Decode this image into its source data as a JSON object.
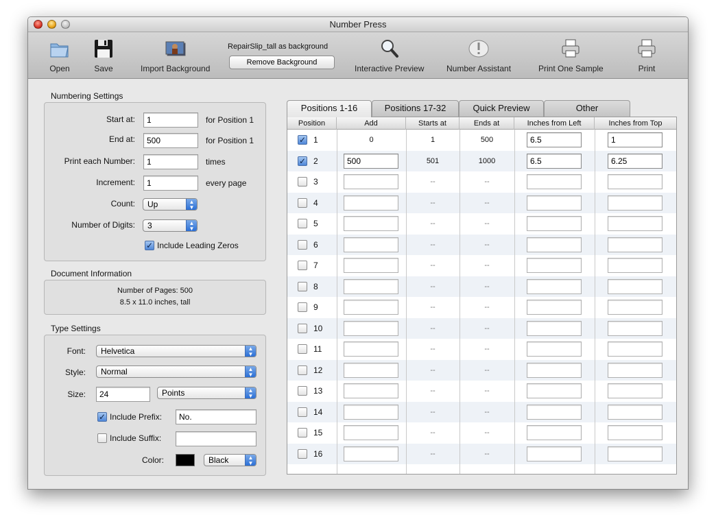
{
  "window": {
    "title": "Number Press"
  },
  "toolbar": {
    "open": "Open",
    "save": "Save",
    "import_background": "Import Background",
    "background_caption": "RepairSlip_tall as background",
    "remove_background": "Remove Background",
    "interactive_preview": "Interactive Preview",
    "number_assistant": "Number Assistant",
    "print_one_sample": "Print One Sample",
    "print": "Print"
  },
  "numbering": {
    "title": "Numbering Settings",
    "start_label": "Start at:",
    "start_value": "1",
    "start_suffix": "for Position 1",
    "end_label": "End at:",
    "end_value": "500",
    "end_suffix": "for Position 1",
    "each_label": "Print each Number:",
    "each_value": "1",
    "each_suffix": "times",
    "increment_label": "Increment:",
    "increment_value": "1",
    "increment_suffix": "every page",
    "count_label": "Count:",
    "count_value": "Up",
    "digits_label": "Number of Digits:",
    "digits_value": "3",
    "leading_zeros_label": "Include Leading Zeros",
    "leading_zeros_checked": true
  },
  "document": {
    "title": "Document Information",
    "pages": "Number of Pages: 500",
    "size": "8.5 x 11.0 inches, tall"
  },
  "type": {
    "title": "Type Settings",
    "font_label": "Font:",
    "font_value": "Helvetica",
    "style_label": "Style:",
    "style_value": "Normal",
    "size_label": "Size:",
    "size_value": "24",
    "size_unit": "Points",
    "prefix_label": "Include Prefix:",
    "prefix_checked": true,
    "prefix_value": "No.",
    "suffix_label": "Include Suffix:",
    "suffix_checked": false,
    "suffix_value": "",
    "color_label": "Color:",
    "color_value": "Black",
    "color_hex": "#000000"
  },
  "tabs": [
    "Positions 1-16",
    "Positions 17-32",
    "Quick Preview",
    "Other"
  ],
  "table": {
    "headers": [
      "Position",
      "Add",
      "Starts at",
      "Ends at",
      "Inches from Left",
      "Inches from Top"
    ],
    "rows": [
      {
        "pos": "1",
        "checked": true,
        "add": "0",
        "starts": "1",
        "ends": "500",
        "left": "6.5",
        "top": "1"
      },
      {
        "pos": "2",
        "checked": true,
        "add": "500",
        "starts": "501",
        "ends": "1000",
        "left": "6.5",
        "top": "6.25"
      },
      {
        "pos": "3",
        "checked": false,
        "add": "",
        "starts": "--",
        "ends": "--",
        "left": "",
        "top": ""
      },
      {
        "pos": "4",
        "checked": false,
        "add": "",
        "starts": "--",
        "ends": "--",
        "left": "",
        "top": ""
      },
      {
        "pos": "5",
        "checked": false,
        "add": "",
        "starts": "--",
        "ends": "--",
        "left": "",
        "top": ""
      },
      {
        "pos": "6",
        "checked": false,
        "add": "",
        "starts": "--",
        "ends": "--",
        "left": "",
        "top": ""
      },
      {
        "pos": "7",
        "checked": false,
        "add": "",
        "starts": "--",
        "ends": "--",
        "left": "",
        "top": ""
      },
      {
        "pos": "8",
        "checked": false,
        "add": "",
        "starts": "--",
        "ends": "--",
        "left": "",
        "top": ""
      },
      {
        "pos": "9",
        "checked": false,
        "add": "",
        "starts": "--",
        "ends": "--",
        "left": "",
        "top": ""
      },
      {
        "pos": "10",
        "checked": false,
        "add": "",
        "starts": "--",
        "ends": "--",
        "left": "",
        "top": ""
      },
      {
        "pos": "11",
        "checked": false,
        "add": "",
        "starts": "--",
        "ends": "--",
        "left": "",
        "top": ""
      },
      {
        "pos": "12",
        "checked": false,
        "add": "",
        "starts": "--",
        "ends": "--",
        "left": "",
        "top": ""
      },
      {
        "pos": "13",
        "checked": false,
        "add": "",
        "starts": "--",
        "ends": "--",
        "left": "",
        "top": ""
      },
      {
        "pos": "14",
        "checked": false,
        "add": "",
        "starts": "--",
        "ends": "--",
        "left": "",
        "top": ""
      },
      {
        "pos": "15",
        "checked": false,
        "add": "",
        "starts": "--",
        "ends": "--",
        "left": "",
        "top": ""
      },
      {
        "pos": "16",
        "checked": false,
        "add": "",
        "starts": "--",
        "ends": "--",
        "left": "",
        "top": ""
      }
    ]
  }
}
